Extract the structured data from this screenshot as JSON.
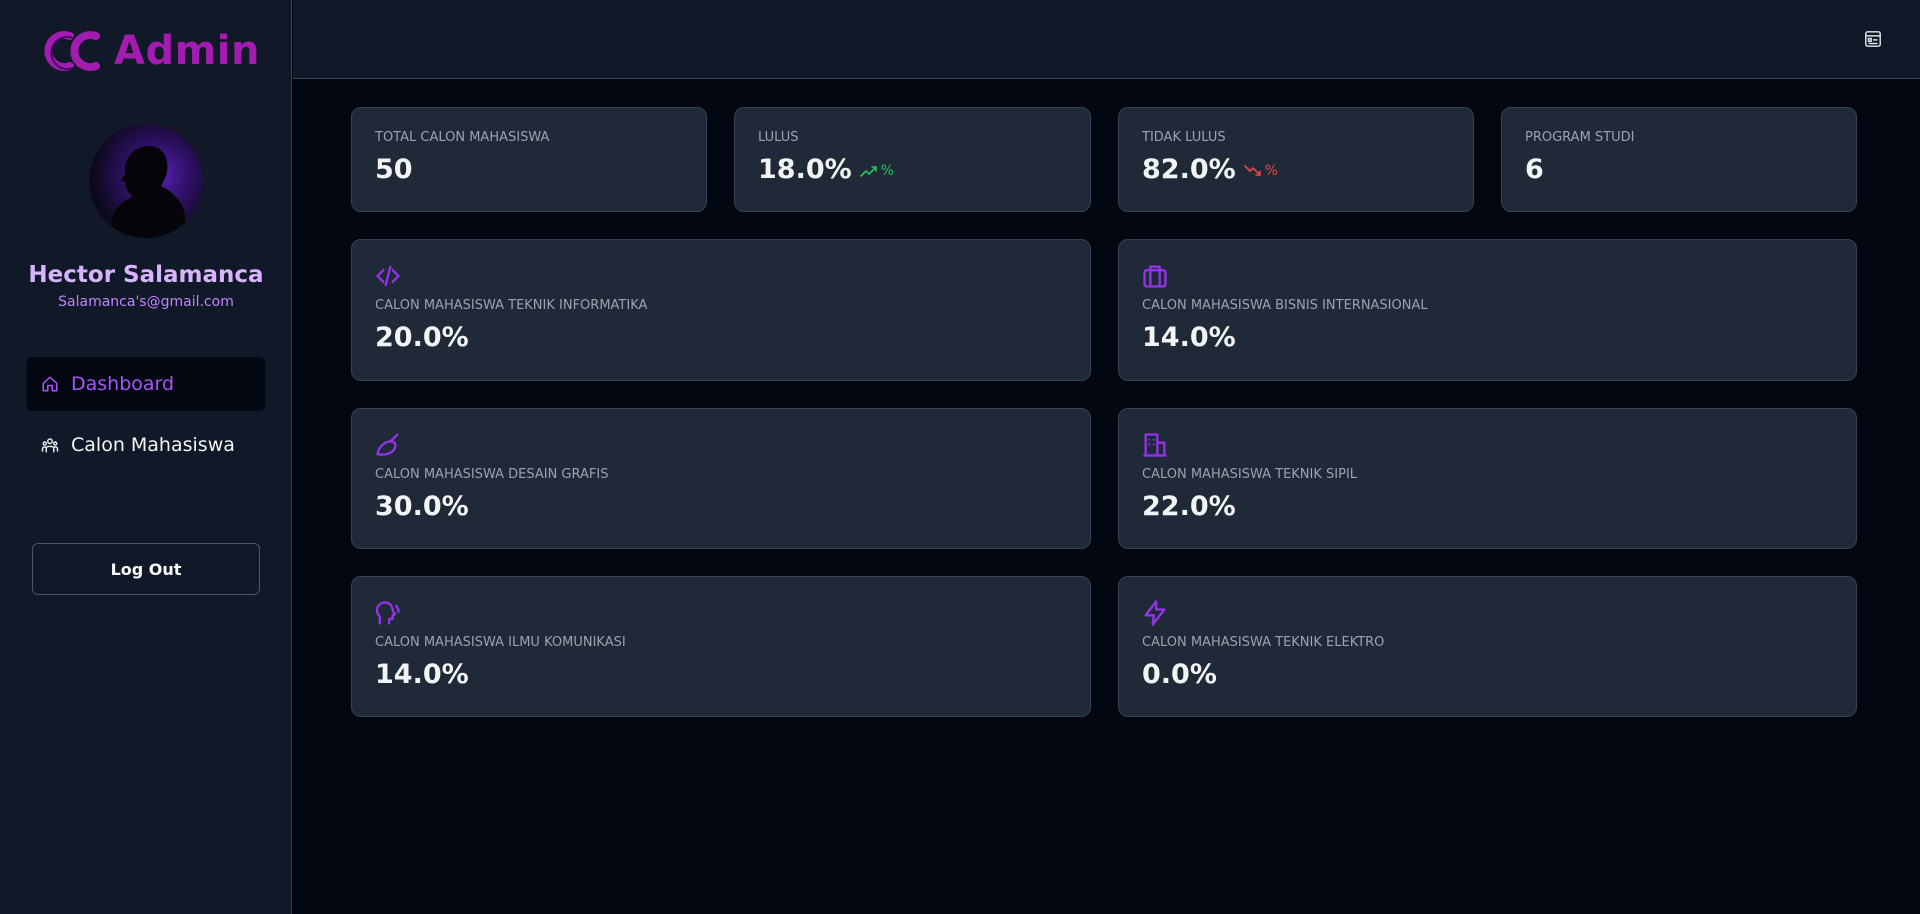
{
  "app": {
    "logo_text": "Admin",
    "accent_color": "#a21caf"
  },
  "profile": {
    "name": "Hector Salamanca",
    "email": "Salamanca's@gmail.com"
  },
  "nav": {
    "items": [
      {
        "label": "Dashboard",
        "icon": "home-icon",
        "active": true
      },
      {
        "label": "Calon Mahasiswa",
        "icon": "users-icon",
        "active": false
      }
    ],
    "logout_label": "Log Out"
  },
  "topbar": {
    "icon": "list-box-icon"
  },
  "stats": [
    {
      "label": "TOTAL CALON MAHASISWA",
      "value": "50"
    },
    {
      "label": "LULUS",
      "value": "18.0%",
      "trend": "%",
      "trend_dir": "up",
      "trend_color": "#22c55e"
    },
    {
      "label": "TIDAK LULUS",
      "value": "82.0%",
      "trend": "%",
      "trend_dir": "down",
      "trend_color": "#ef4444"
    },
    {
      "label": "PROGRAM STUDI",
      "value": "6"
    }
  ],
  "programs": [
    {
      "label": "CALON MAHASISWA TEKNIK INFORMATIKA",
      "value": "20.0%",
      "icon": "code-icon"
    },
    {
      "label": "CALON MAHASISWA BISNIS INTERNASIONAL",
      "value": "14.0%",
      "icon": "briefcase-icon"
    },
    {
      "label": "CALON MAHASISWA DESAIN GRAFIS",
      "value": "30.0%",
      "icon": "brush-icon"
    },
    {
      "label": "CALON MAHASISWA TEKNIK SIPIL",
      "value": "22.0%",
      "icon": "building-icon"
    },
    {
      "label": "CALON MAHASISWA ILMU KOMUNIKASI",
      "value": "14.0%",
      "icon": "speaking-head-icon"
    },
    {
      "label": "CALON MAHASISWA TEKNIK ELEKTRO",
      "value": "0.0%",
      "icon": "lightning-icon"
    }
  ]
}
